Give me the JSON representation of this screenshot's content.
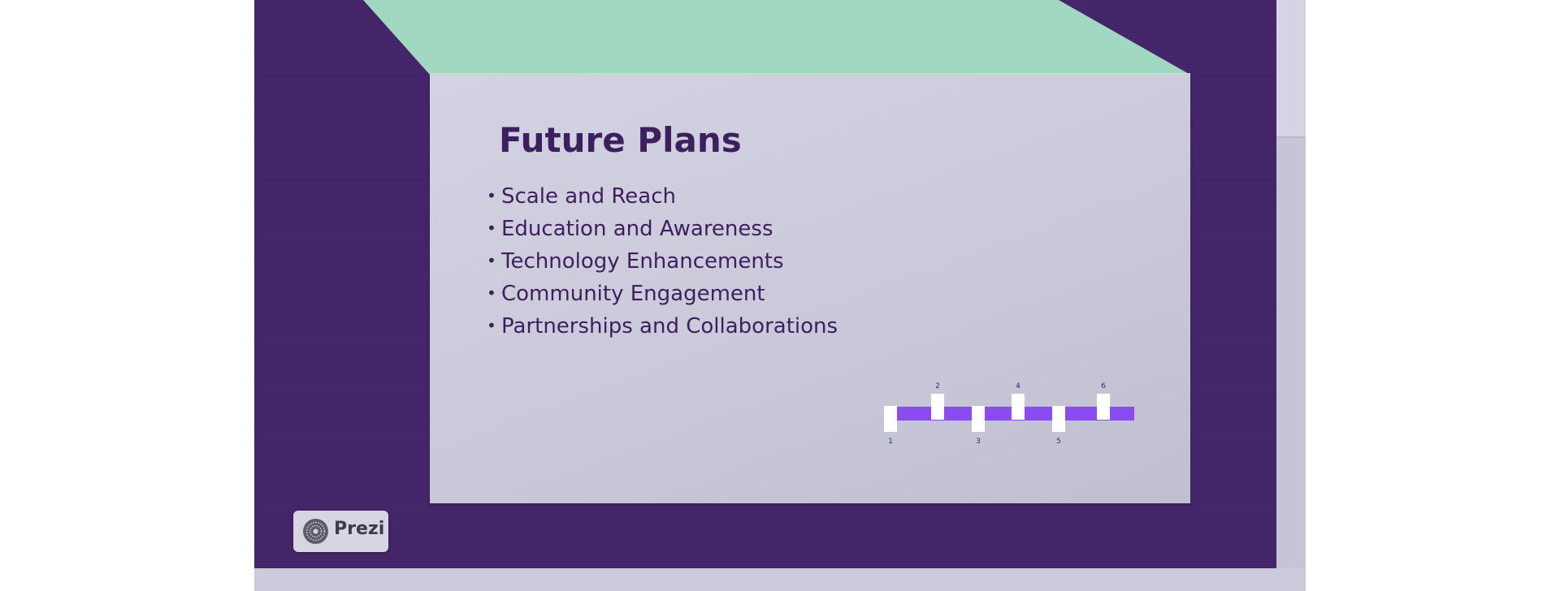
{
  "slide": {
    "title": "Future Plans",
    "bullet_char": "•",
    "bullets": [
      "Scale and Reach",
      "Education and Awareness",
      "Technology Enhancements",
      "Community Engagement",
      "Partnerships and Collaborations"
    ]
  },
  "timeline": {
    "steps": [
      "1",
      "2",
      "3",
      "4",
      "5",
      "6"
    ]
  },
  "branding": {
    "logo_text": "Prezi"
  },
  "colors": {
    "background_purple": "#46266b",
    "mint_panel": "#a2d8c2",
    "card": "#c9c9da",
    "title_text": "#3d1f5e",
    "timeline_bar": "#8a4cf0",
    "timeline_marker": "#ffffff"
  }
}
